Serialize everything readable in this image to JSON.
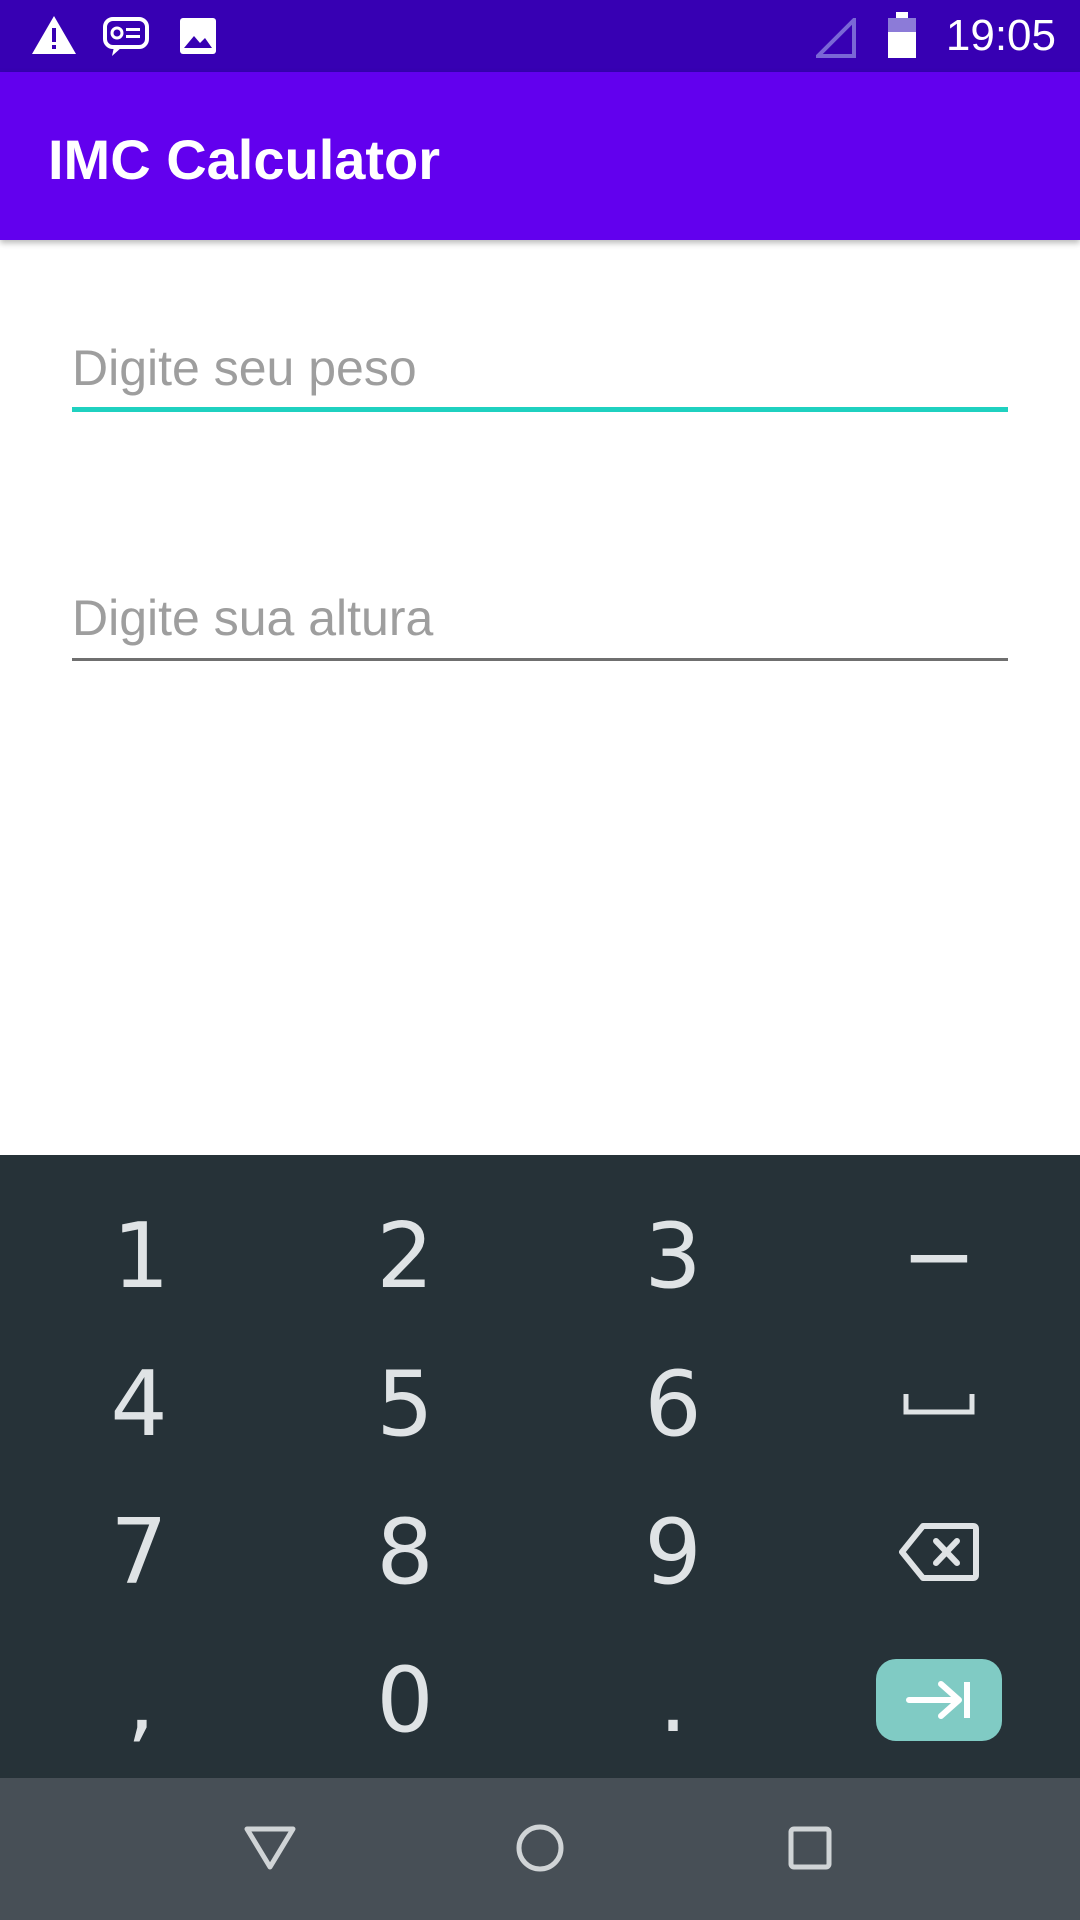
{
  "status_bar": {
    "time": "19:05",
    "icons": [
      "warning-icon",
      "message-icon",
      "image-icon",
      "signal-icon",
      "battery-icon"
    ]
  },
  "app_bar": {
    "title": "IMC Calculator"
  },
  "form": {
    "weight_placeholder": "Digite seu peso",
    "height_placeholder": "Digite sua altura"
  },
  "colors": {
    "status_bar": "#3700b3",
    "app_bar": "#6200ee",
    "accent": "#1fd1c0",
    "keyboard_bg": "#263238",
    "enter_key": "#80cbc4",
    "nav_bar": "#474f56"
  },
  "keyboard": {
    "keys": [
      "1",
      "2",
      "3",
      "−",
      "4",
      "5",
      "6",
      "␣",
      "7",
      "8",
      "9",
      "⌫",
      ",",
      "0",
      ".",
      "⇥"
    ],
    "enter_icon": "tab-next-icon",
    "space_icon": "space-icon",
    "backspace_icon": "backspace-icon"
  },
  "nav_bar": {
    "icons": [
      "back-icon",
      "home-icon",
      "recents-icon"
    ]
  }
}
